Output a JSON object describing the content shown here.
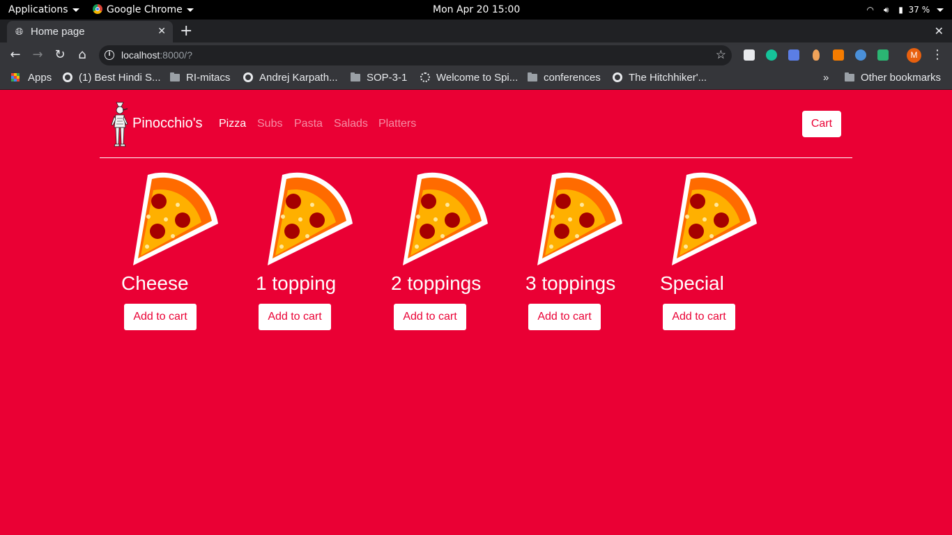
{
  "system_bar": {
    "applications": "Applications",
    "app_name": "Google Chrome",
    "datetime": "Mon Apr 20  15:00",
    "battery": "37 %"
  },
  "browser": {
    "tab_title": "Home page",
    "url_host": "localhost",
    "url_rest": ":8000/?",
    "profile_initial": "M",
    "bookmarks": [
      {
        "label": "Apps",
        "icon": "apps-grid-icon"
      },
      {
        "label": "(1) Best Hindi S...",
        "icon": "globe-icon"
      },
      {
        "label": "RI-mitacs",
        "icon": "folder-icon"
      },
      {
        "label": "Andrej Karpath...",
        "icon": "globe-icon"
      },
      {
        "label": "SOP-3-1",
        "icon": "folder-icon"
      },
      {
        "label": "Welcome to Spi...",
        "icon": "spinner-site-icon"
      },
      {
        "label": "conferences",
        "icon": "folder-icon"
      },
      {
        "label": "The Hitchhiker'...",
        "icon": "globe-icon"
      }
    ],
    "more_bookmarks": "»",
    "other_bookmarks": "Other bookmarks"
  },
  "site": {
    "brand": "Pinocchio's",
    "nav": [
      {
        "label": "Pizza",
        "active": true
      },
      {
        "label": "Subs",
        "active": false
      },
      {
        "label": "Pasta",
        "active": false
      },
      {
        "label": "Salads",
        "active": false
      },
      {
        "label": "Platters",
        "active": false
      }
    ],
    "cart_label": "Cart",
    "colors": {
      "background": "#ea0034",
      "button_text": "#ea0034"
    },
    "products": [
      {
        "name": "Cheese",
        "button": "Add to cart"
      },
      {
        "name": "1 topping",
        "button": "Add to cart"
      },
      {
        "name": "2 toppings",
        "button": "Add to cart"
      },
      {
        "name": "3 toppings",
        "button": "Add to cart"
      },
      {
        "name": "Special",
        "button": "Add to cart"
      }
    ]
  }
}
